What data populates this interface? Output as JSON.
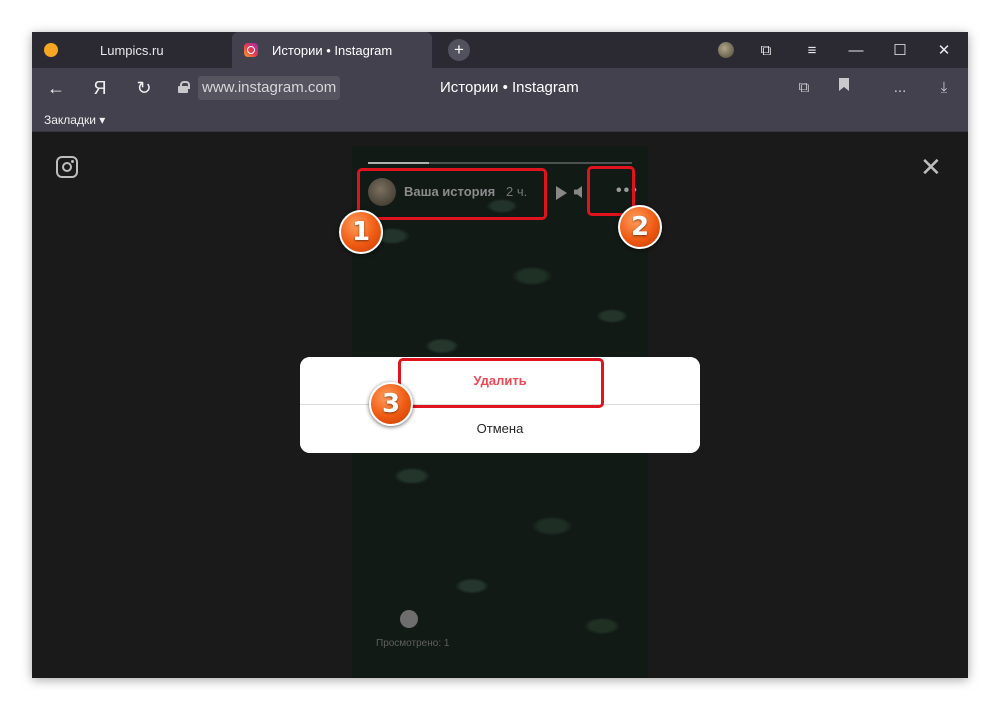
{
  "browser": {
    "tabs": [
      {
        "label": "Lumpics.ru",
        "active": false,
        "icon": "orange-circle-favicon"
      },
      {
        "label": "Истории • Instagram",
        "active": true,
        "icon": "instagram-favicon"
      }
    ],
    "new_tab_label": "+",
    "window_controls": {
      "bookmarks_icon": "⧉",
      "menu_icon": "≡",
      "minimize": "—",
      "maximize": "☐",
      "close": "✕"
    },
    "nav": {
      "back": "←",
      "yandex": "Я",
      "reload": "↻"
    },
    "url": "www.instagram.com",
    "page_title": "Истории • Instagram",
    "right_icons": {
      "copy": "⧉",
      "bookmark": "🔖",
      "more": "...",
      "download": "⤓"
    },
    "bookmarks_bar_label": "Закладки ▾"
  },
  "story": {
    "user": "Ваша история",
    "time": "2 ч.",
    "more_label": "•••",
    "viewed_label": "Просмотрено: 1",
    "progress": 0.23
  },
  "modal": {
    "delete_label": "Удалить",
    "cancel_label": "Отмена"
  },
  "annotations": [
    {
      "number": "1"
    },
    {
      "number": "2"
    },
    {
      "number": "3"
    }
  ],
  "colors": {
    "highlight": "#e0141e",
    "badge": "#ef5a12",
    "delete_text": "#ed4956"
  }
}
